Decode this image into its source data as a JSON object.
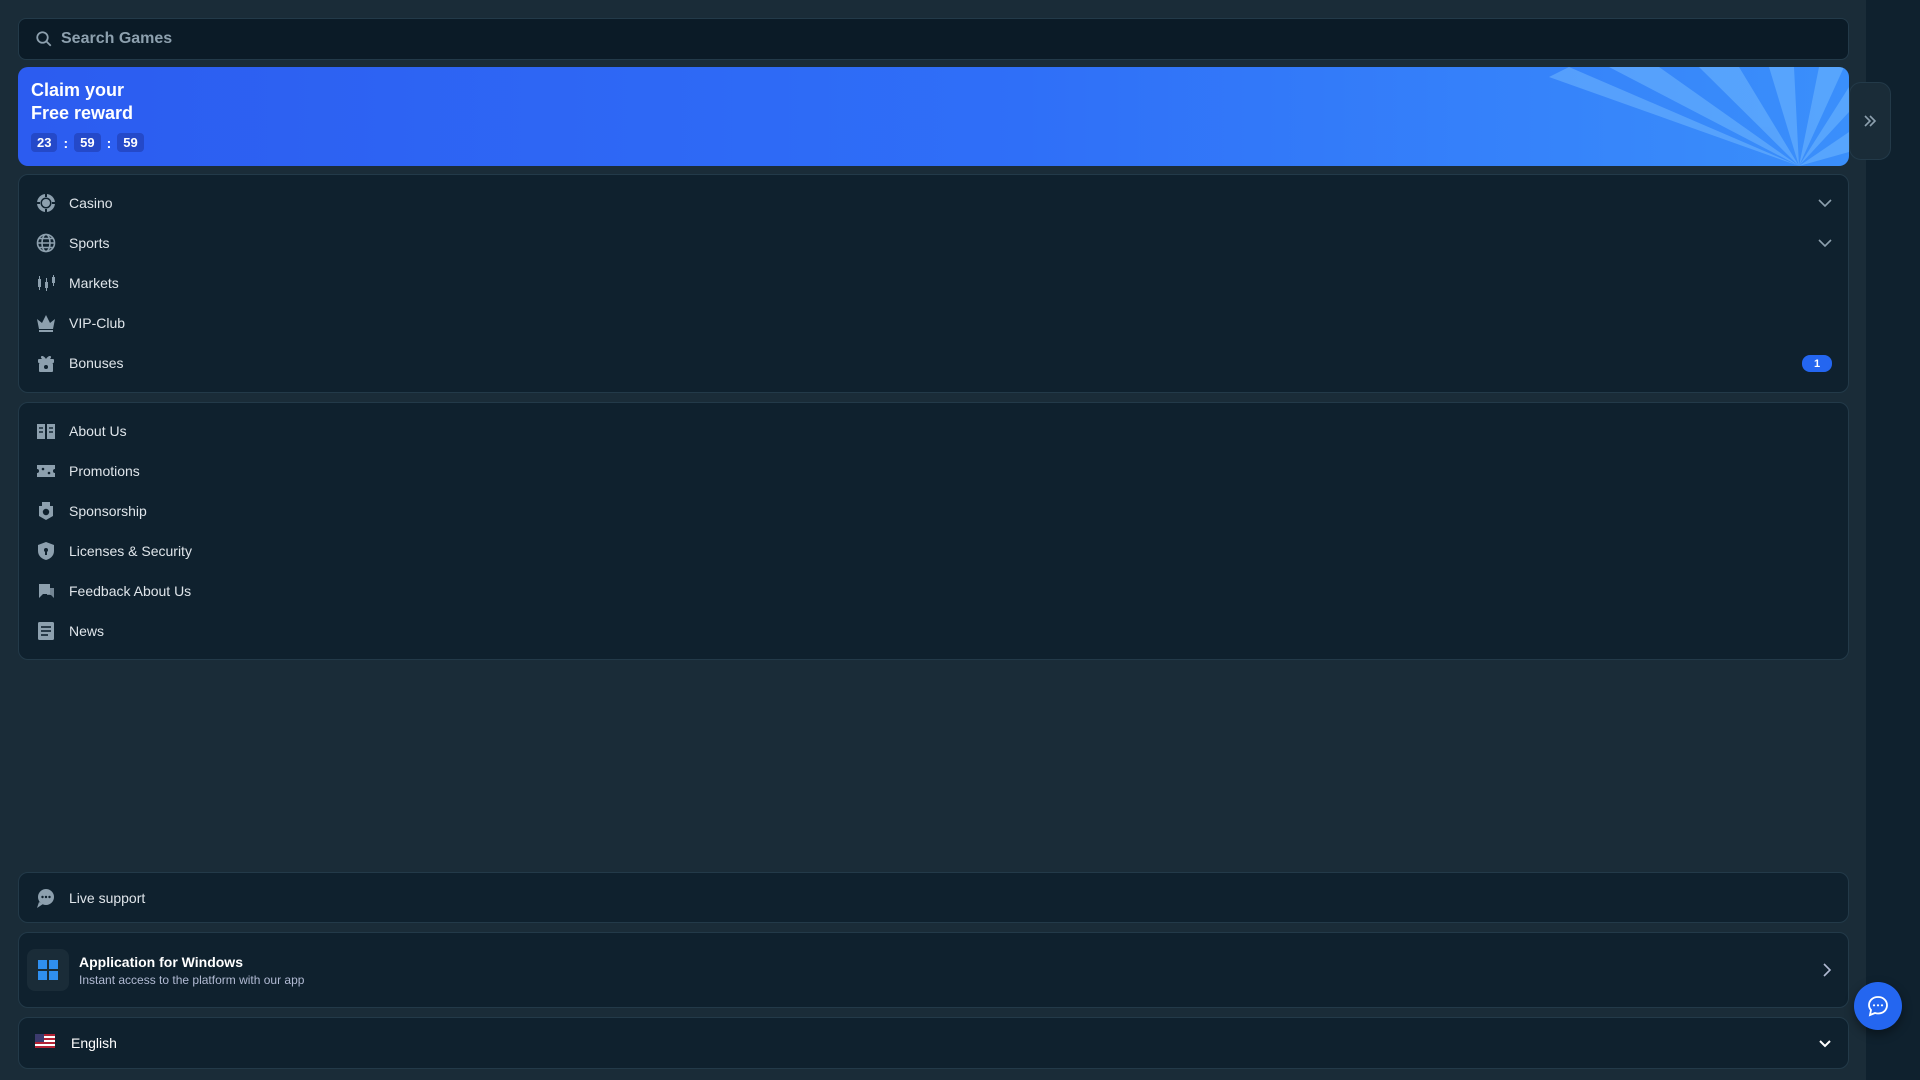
{
  "search": {
    "placeholder": "Search Games"
  },
  "banner": {
    "title_line1": "Claim your",
    "title_line2": "Free reward",
    "timer": {
      "hours": "23",
      "minutes": "59",
      "seconds": "59",
      "separator": ":"
    }
  },
  "main_nav": [
    {
      "label": "Casino",
      "icon": "casino-chip-icon",
      "expandable": true
    },
    {
      "label": "Sports",
      "icon": "globe-icon",
      "expandable": true
    },
    {
      "label": "Markets",
      "icon": "candlestick-icon",
      "expandable": false
    },
    {
      "label": "VIP-Club",
      "icon": "crown-icon",
      "expandable": false
    },
    {
      "label": "Bonuses",
      "icon": "gift-icon",
      "expandable": false,
      "badge": "1"
    }
  ],
  "info_nav": [
    {
      "label": "About Us",
      "icon": "book-icon"
    },
    {
      "label": "Promotions",
      "icon": "ticket-icon"
    },
    {
      "label": "Sponsorship",
      "icon": "medal-icon"
    },
    {
      "label": "Licenses & Security",
      "icon": "shield-icon"
    },
    {
      "label": "Feedback About Us",
      "icon": "feedback-icon"
    },
    {
      "label": "News",
      "icon": "newspaper-icon"
    }
  ],
  "live_support": {
    "label": "Live support",
    "icon": "support-chat-icon"
  },
  "windows_app": {
    "title": "Application for Windows",
    "subtitle": "Instant access to the platform with our app",
    "icon": "windows-icon"
  },
  "language": {
    "label": "English",
    "icon": "us-flag-icon"
  },
  "colors": {
    "accent": "#2466f0",
    "panel": "#0f212e",
    "background": "#1a2c38"
  }
}
